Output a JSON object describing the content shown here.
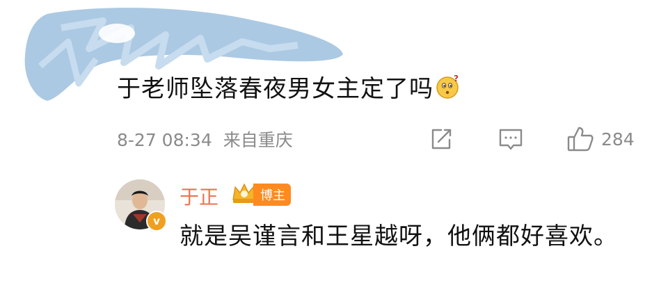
{
  "comment": {
    "text": "于老师坠落春夜男女主定了吗",
    "emoji": "thinking-face-icon",
    "time": "8-27 08:34",
    "location": "来自重庆",
    "like_count": "284"
  },
  "reply": {
    "author": "于正",
    "badge_label": "博主",
    "verified_mark": "v",
    "text": "就是吴谨言和王星越呀，他俩都好喜欢。"
  },
  "colors": {
    "author_name": "#eb7350",
    "badge": "#ff8a1f",
    "meta_text": "#8a8a8a",
    "redaction": "#8fb6d8"
  },
  "icons": [
    "share-icon",
    "comment-icon",
    "like-icon",
    "thinking-face-icon"
  ]
}
